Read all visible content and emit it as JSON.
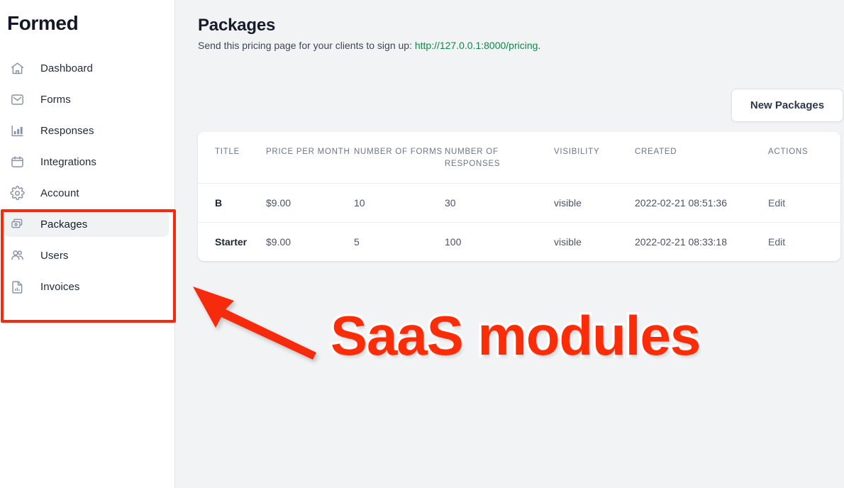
{
  "sidebar": {
    "brand": "Formed",
    "items": [
      {
        "label": "Dashboard",
        "icon": "home-icon",
        "active": false
      },
      {
        "label": "Forms",
        "icon": "inbox-icon",
        "active": false
      },
      {
        "label": "Responses",
        "icon": "bar-chart-icon",
        "active": false
      },
      {
        "label": "Integrations",
        "icon": "calendar-icon",
        "active": false
      },
      {
        "label": "Account",
        "icon": "gear-icon",
        "active": false
      },
      {
        "label": "Packages",
        "icon": "money-stack-icon",
        "active": true
      },
      {
        "label": "Users",
        "icon": "users-icon",
        "active": false
      },
      {
        "label": "Invoices",
        "icon": "document-chart-icon",
        "active": false
      }
    ]
  },
  "header": {
    "title": "Packages",
    "subtitle_prefix": "Send this pricing page for your clients to sign up: ",
    "link_text": "http://127.0.0.1:8000/pricing",
    "subtitle_suffix": ".",
    "link_color": "#14854a"
  },
  "toolbar": {
    "new_package_label": "New Packages"
  },
  "table": {
    "columns": [
      "TITLE",
      "PRICE PER MONTH",
      "NUMBER OF FORMS",
      "NUMBER OF RESPONSES",
      "VISIBILITY",
      "CREATED",
      "ACTIONS"
    ],
    "rows": [
      {
        "title": "B",
        "price": "$9.00",
        "forms": "10",
        "responses": "30",
        "visibility": "visible",
        "created": "2022-02-21 08:51:36",
        "action": "Edit"
      },
      {
        "title": "Starter",
        "price": "$9.00",
        "forms": "5",
        "responses": "100",
        "visibility": "visible",
        "created": "2022-02-21 08:33:18",
        "action": "Edit"
      }
    ]
  },
  "annotation": {
    "text": "SaaS modules",
    "color": "#fb2d09",
    "outline_color": "#ffffff",
    "arrow": "red-arrow-pointing-to-sidebar-group",
    "box": "red-rectangle-around-packages-users-invoices"
  }
}
